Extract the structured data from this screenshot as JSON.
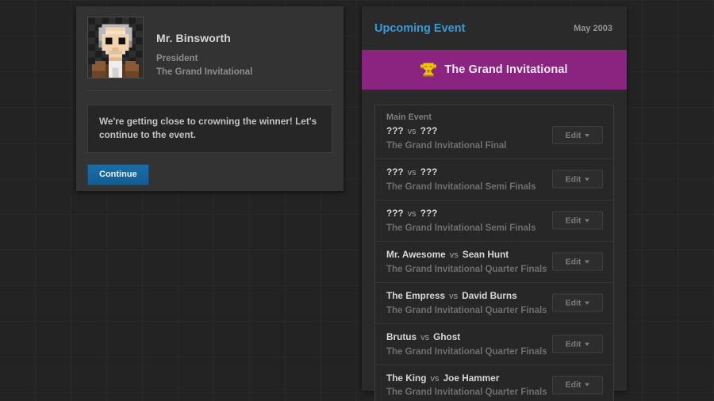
{
  "dialog": {
    "avatar_icon": "promoter-portrait-pixel-avatar",
    "name": "Mr. Binsworth",
    "role": "President",
    "company": "The Grand Invitational",
    "message": "We're getting close to crowning the winner! Let's continue to the event.",
    "continue_label": "Continue",
    "accent_color": "#16639c"
  },
  "event_panel": {
    "topbar_title": "Upcoming Event",
    "topbar_date": "May 2003",
    "banner_icon": "trophy-icon",
    "banner_title": "The Grand Invitational",
    "banner_color": "#8a2480",
    "edit_label": "Edit",
    "matches": [
      {
        "tag": "Main Event",
        "fighter_a": "???",
        "vs": "vs",
        "fighter_b": "???",
        "subtitle": "The Grand Invitational Final"
      },
      {
        "tag": "",
        "fighter_a": "???",
        "vs": "vs",
        "fighter_b": "???",
        "subtitle": "The Grand Invitational Semi Finals"
      },
      {
        "tag": "",
        "fighter_a": "???",
        "vs": "vs",
        "fighter_b": "???",
        "subtitle": "The Grand Invitational Semi Finals"
      },
      {
        "tag": "",
        "fighter_a": "Mr. Awesome",
        "vs": "vs",
        "fighter_b": "Sean Hunt",
        "subtitle": "The Grand Invitational Quarter Finals"
      },
      {
        "tag": "",
        "fighter_a": "The Empress",
        "vs": "vs",
        "fighter_b": "David Burns",
        "subtitle": "The Grand Invitational Quarter Finals"
      },
      {
        "tag": "",
        "fighter_a": "Brutus",
        "vs": "vs",
        "fighter_b": "Ghost",
        "subtitle": "The Grand Invitational Quarter Finals"
      },
      {
        "tag": "",
        "fighter_a": "The King",
        "vs": "vs",
        "fighter_b": "Joe Hammer",
        "subtitle": "The Grand Invitational Quarter Finals"
      }
    ]
  }
}
